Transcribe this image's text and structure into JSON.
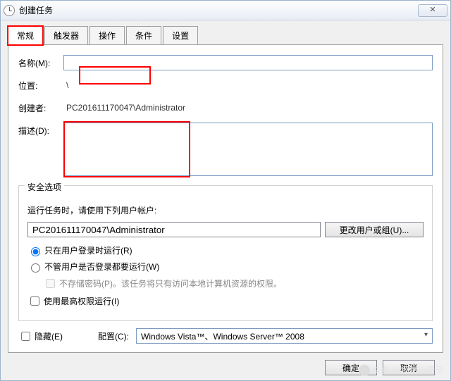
{
  "window": {
    "title": "创建任务"
  },
  "tabs": {
    "general": "常规",
    "triggers": "触发器",
    "actions": "操作",
    "conditions": "条件",
    "settings": "设置"
  },
  "labels": {
    "name": "名称(M):",
    "location": "位置:",
    "creator": "创建者:",
    "description": "描述(D):",
    "security_legend": "安全选项",
    "security_prompt": "运行任务时，请使用下列用户帐户:",
    "change_user_btn": "更改用户或组(U)...",
    "radio_logged_on": "只在用户登录时运行(R)",
    "radio_any": "不管用户是否登录都要运行(W)",
    "no_store_pw": "不存储密码(P)。该任务将只有访问本地计算机资源的权限。",
    "highest_priv": "使用最高权限运行(I)",
    "hidden": "隐藏(E)",
    "configure_for": "配置(C):",
    "ok": "确定",
    "cancel": "取消"
  },
  "values": {
    "name": "",
    "location": "\\",
    "creator": "PC201611170047\\Administrator",
    "description": "",
    "user_account": "PC201611170047\\Administrator",
    "configure_sel": "Windows Vista™、Windows Server™ 2008"
  },
  "watermark": "头条 @程序小精灵"
}
